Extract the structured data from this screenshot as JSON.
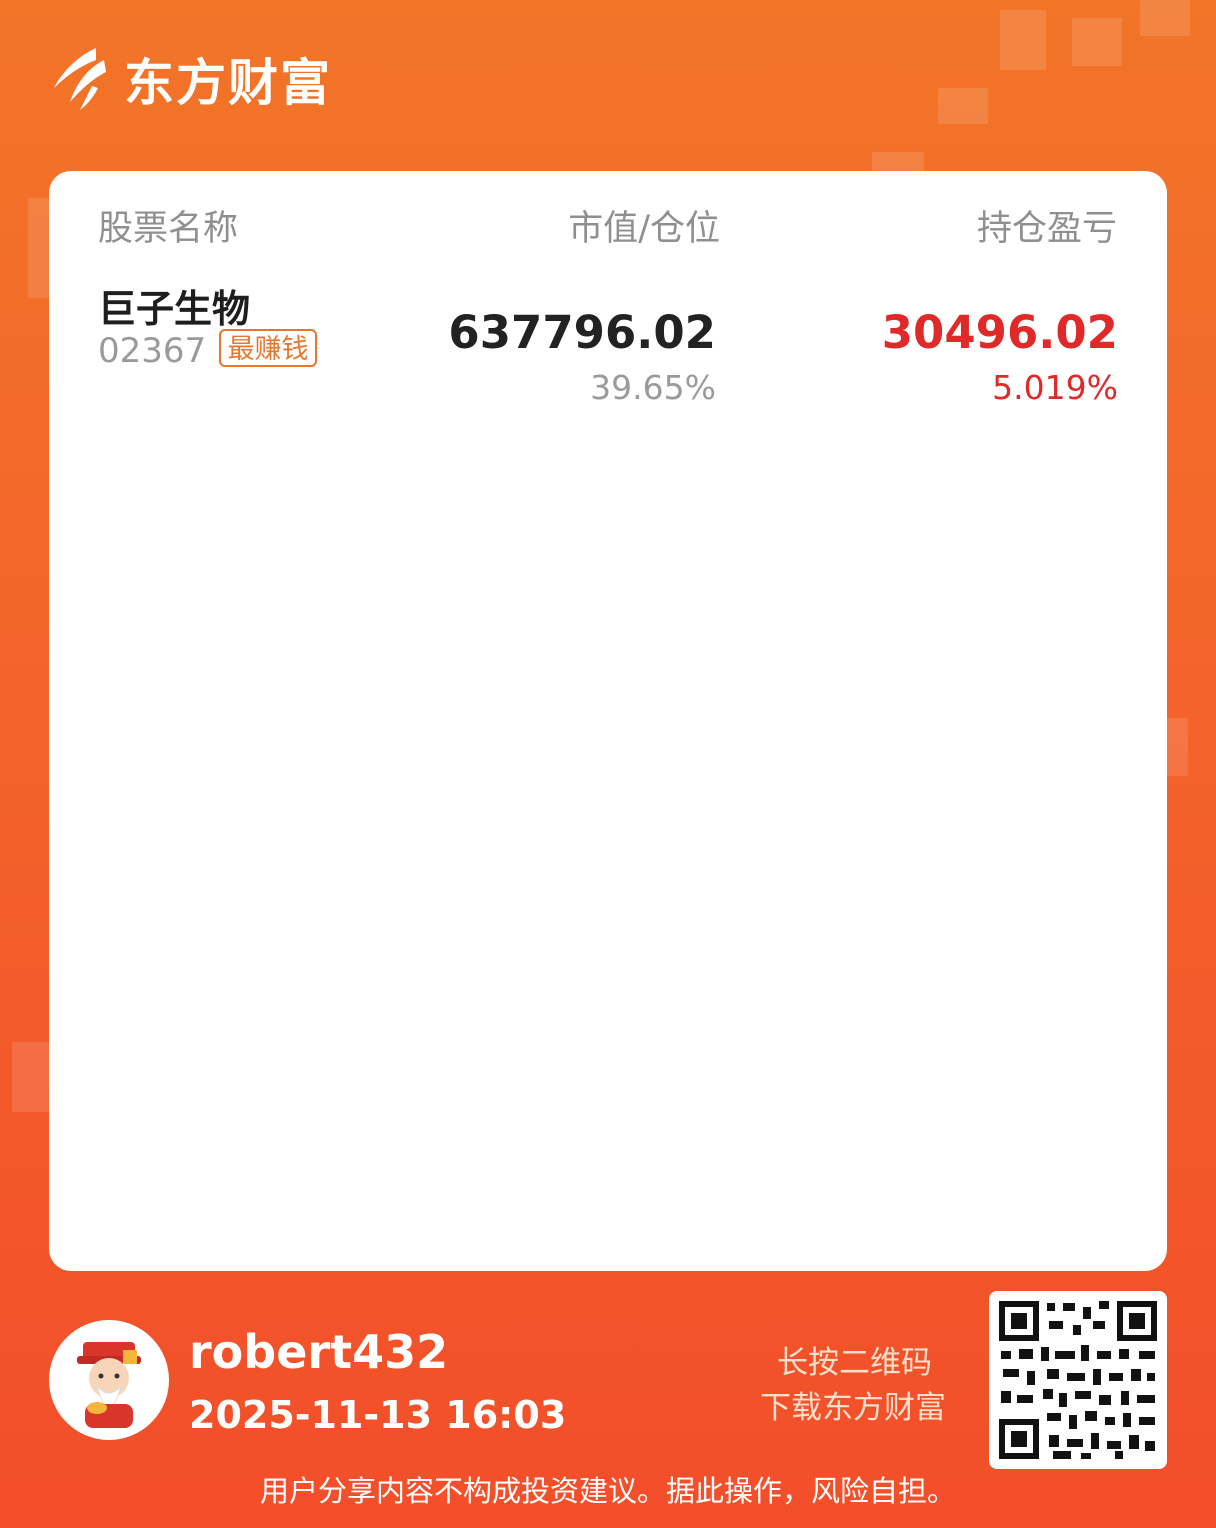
{
  "brand": {
    "name": "东方财富"
  },
  "table": {
    "headers": {
      "name": "股票名称",
      "value": "市值/仓位",
      "pl": "持仓盈亏"
    },
    "rows": [
      {
        "name": "巨子生物",
        "code": "02367",
        "tag": "最赚钱",
        "market_value": "637796.02",
        "position": "39.65%",
        "profit": "30496.02",
        "profit_pct": "5.019%"
      }
    ]
  },
  "footer": {
    "username": "robert432",
    "datetime": "2025-11-13 16:03",
    "prompt_line1": "长按二维码",
    "prompt_line2": "下载东方财富",
    "disclaimer": "用户分享内容不构成投资建议。据此操作，风险自担。"
  },
  "colors": {
    "accent": "#f3642a",
    "profit": "#e02a2a",
    "tag": "#e8772e"
  }
}
